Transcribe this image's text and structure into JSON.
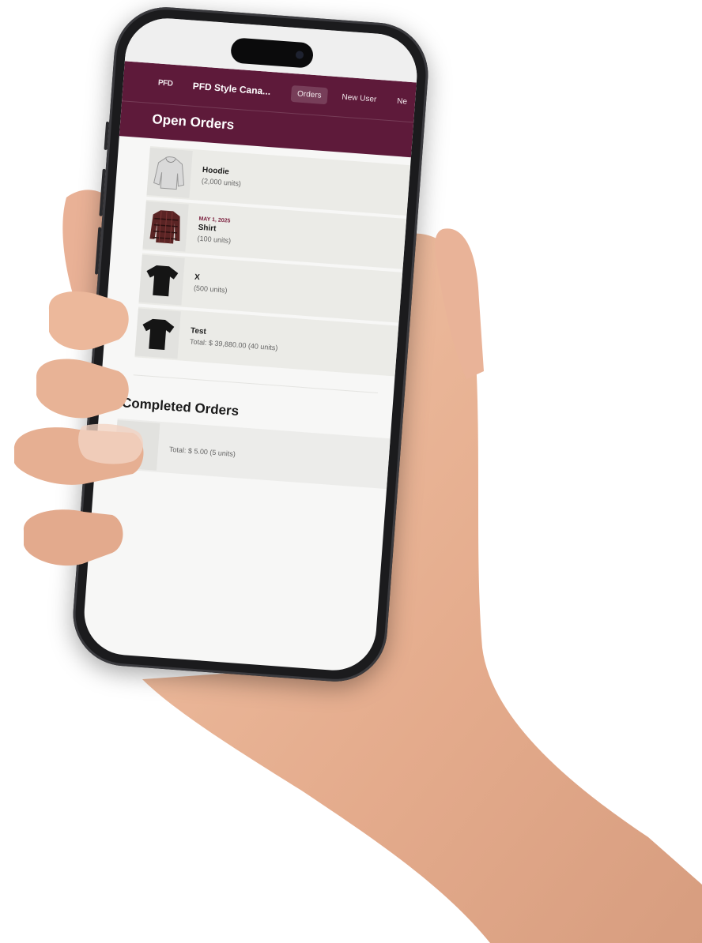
{
  "app": {
    "brand": "PFD Style Cana...",
    "logo_text": "PFD"
  },
  "nav": {
    "items": [
      {
        "label": "Orders",
        "active": true
      },
      {
        "label": "New User",
        "active": false
      },
      {
        "label": "Ne",
        "active": false
      }
    ]
  },
  "open_orders": {
    "title": "Open Orders",
    "items": [
      {
        "date": "",
        "name": "Hoodie",
        "detail": "(2,000 units)",
        "icon": "hoodie-icon"
      },
      {
        "date": "MAY 1, 2025",
        "name": "Shirt",
        "detail": "(100 units)",
        "icon": "plaid-shirt-icon"
      },
      {
        "date": "",
        "name": "X",
        "detail": "(500 units)",
        "icon": "tshirt-icon"
      },
      {
        "date": "",
        "name": "Test",
        "detail": "Total: $ 39,880.00 (40 units)",
        "icon": "tshirt-icon"
      }
    ]
  },
  "completed_orders": {
    "title": "Completed Orders",
    "items": [
      {
        "detail": "Total: $ 5.00 (5 units)"
      }
    ]
  },
  "colors": {
    "header": "#5e1a3a",
    "accent_date": "#7a1d3c",
    "screen_bg": "#f7f7f6",
    "phone_frame": "#1b1b1d",
    "skin": "#e9b69a"
  }
}
